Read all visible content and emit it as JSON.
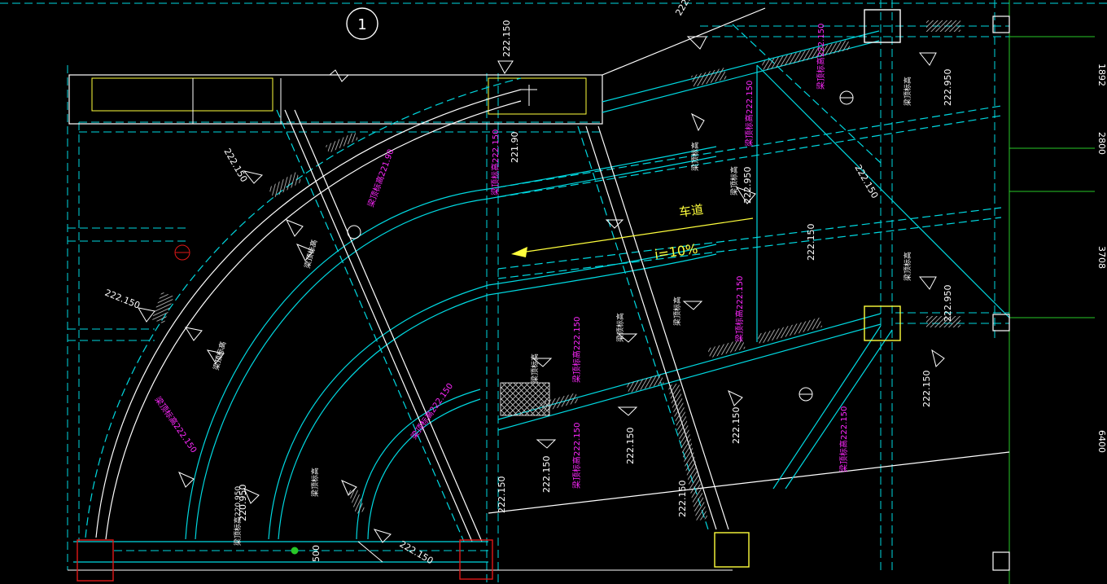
{
  "drawing": {
    "axis_bubble": "1",
    "ramp_label": "车道",
    "slope_label": "i=10%",
    "grid_dims_right": [
      "1892",
      "2800",
      "3708",
      "6400"
    ],
    "dim_bottom": "500",
    "elevations": {
      "e1": "222.150",
      "e2": "222.150",
      "e3": "222.150",
      "e4": "222.150",
      "e5": "222.150",
      "e6": "222.950",
      "e7": "222.950",
      "e8": "222.150",
      "e9": "222.150",
      "e10": "222.150",
      "e11": "222.150",
      "e12": "222.150",
      "e13": "221.90",
      "e14": "220.950",
      "e15": "222.150",
      "e16": "222.150",
      "e17": "222.150",
      "e18": "222.950"
    },
    "magenta_notes": {
      "m1": "梁顶标高222.150",
      "m2": "梁顶标高222.150",
      "m3": "梁顶标高222.150",
      "m4": "梁顶标高222.150",
      "m5": "梁顶标高222.150",
      "m6": "梁顶标高222.150",
      "m7": "梁顶标高221.90",
      "m8": "梁顶标高222.150",
      "m9": "梁顶标高222.150",
      "m10": "梁顶标高222.150"
    },
    "white_notes": {
      "w1": "梁顶标高",
      "w2": "梁顶标高",
      "w3": "梁顶标高",
      "w4": "梁顶标高",
      "w5": "梁顶标高",
      "w6": "梁顶标高",
      "w7": "梁顶标高",
      "w8": "梁顶标高220.950",
      "w9": "梁顶标高",
      "w10": "梁顶标高",
      "w11": "梁顶标高"
    }
  },
  "colors": {
    "background": "#000000",
    "cyan": "#00d8e0",
    "white": "#ffffff",
    "yellow": "#ffff3c",
    "magenta": "#ff28ff",
    "red": "#e01818",
    "green": "#28c828",
    "grey": "#8c8c8c"
  }
}
